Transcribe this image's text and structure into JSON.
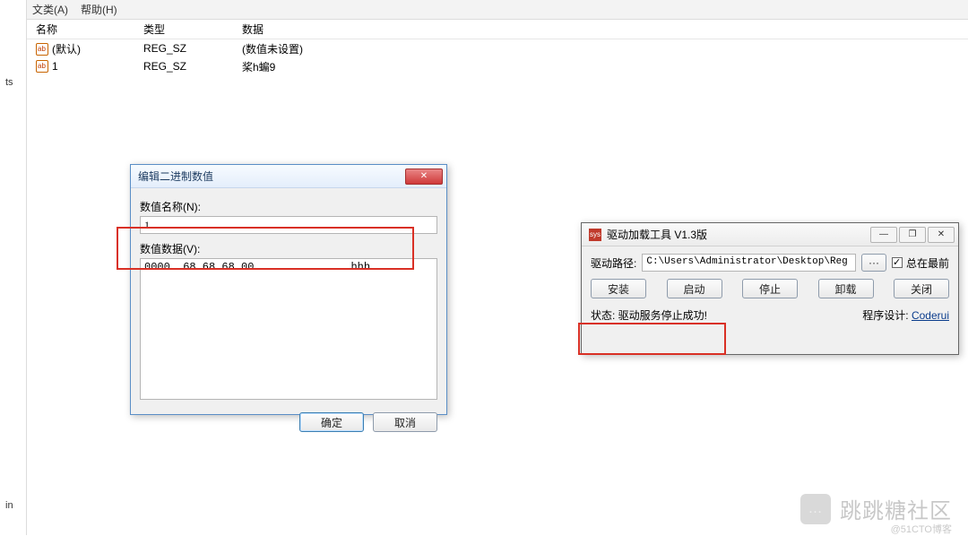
{
  "menu": {
    "category": "文类(A)",
    "help": "帮助(H)"
  },
  "sidebar": {
    "ts": "ts",
    "in": "in"
  },
  "columns": {
    "name": "名称",
    "type": "类型",
    "data": "数据"
  },
  "rows": [
    {
      "name": "(默认)",
      "type": "REG_SZ",
      "data": "(数值未设置)"
    },
    {
      "name": "1",
      "type": "REG_SZ",
      "data": "桨h蝙9"
    }
  ],
  "binary_dialog": {
    "title": "编辑二进制数值",
    "name_label": "数值名称(N):",
    "name_value": "1",
    "data_label": "数值数据(V):",
    "hex_line": "0000  68 68 68 00               hhh.",
    "ok": "确定",
    "cancel": "取消",
    "close_glyph": "✕"
  },
  "driver_dialog": {
    "sys_tag": "sys",
    "title": "驱动加载工具 V1.3版",
    "min_glyph": "—",
    "restore_glyph": "❐",
    "close_glyph": "✕",
    "path_label": "驱动路径:",
    "path_value": "C:\\Users\\Administrator\\Desktop\\Reg",
    "browse": "···",
    "always_top": "总在最前",
    "always_top_checked": true,
    "buttons": {
      "install": "安装",
      "start": "启动",
      "stop": "停止",
      "unload": "卸载",
      "close": "关闭"
    },
    "status": "状态: 驱动服务停止成功!",
    "credit_label": "程序设计:",
    "credit_name": "Coderui"
  },
  "watermark": {
    "text": "跳跳糖社区",
    "sub": "@51CTO博客",
    "icon": "…"
  }
}
